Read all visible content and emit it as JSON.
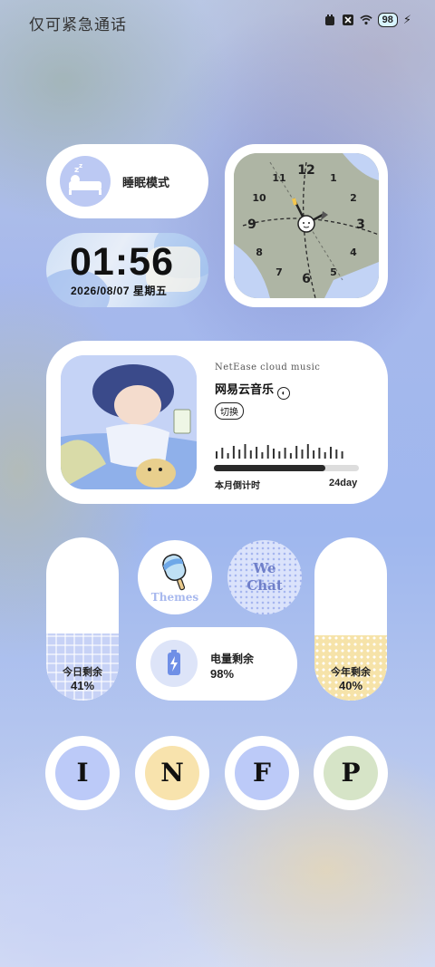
{
  "status_bar": {
    "text": "仅可紧急通话",
    "battery": "98"
  },
  "sleep_widget": {
    "label": "睡眠模式"
  },
  "time_widget": {
    "time": "01:56",
    "date": "2026/08/07 星期五"
  },
  "clock_widget": {
    "numbers": [
      "12",
      "1",
      "2",
      "3",
      "4",
      "5",
      "6",
      "7",
      "8",
      "9",
      "10",
      "11"
    ]
  },
  "music_widget": {
    "subtitle": "NetEase cloud music",
    "title": "网易云音乐",
    "switch_label": "切换",
    "countdown_label": "本月倒计时",
    "countdown_value": "24day",
    "progress": 0.77
  },
  "day_pill": {
    "label": "今日剩余",
    "value": "41%",
    "fill": 0.41
  },
  "year_pill": {
    "label": "今年剩余",
    "value": "40%",
    "fill": 0.4
  },
  "themes_app": {
    "label": "Themes"
  },
  "wechat_app": {
    "line1": "We",
    "line2": "Chat"
  },
  "battery_widget": {
    "label": "电量剩余",
    "value": "98%"
  },
  "mbti": [
    {
      "letter": "I",
      "color": "#bccaf8"
    },
    {
      "letter": "N",
      "color": "#f8e3ad"
    },
    {
      "letter": "F",
      "color": "#bccaf8"
    },
    {
      "letter": "P",
      "color": "#d6e4c7"
    }
  ]
}
